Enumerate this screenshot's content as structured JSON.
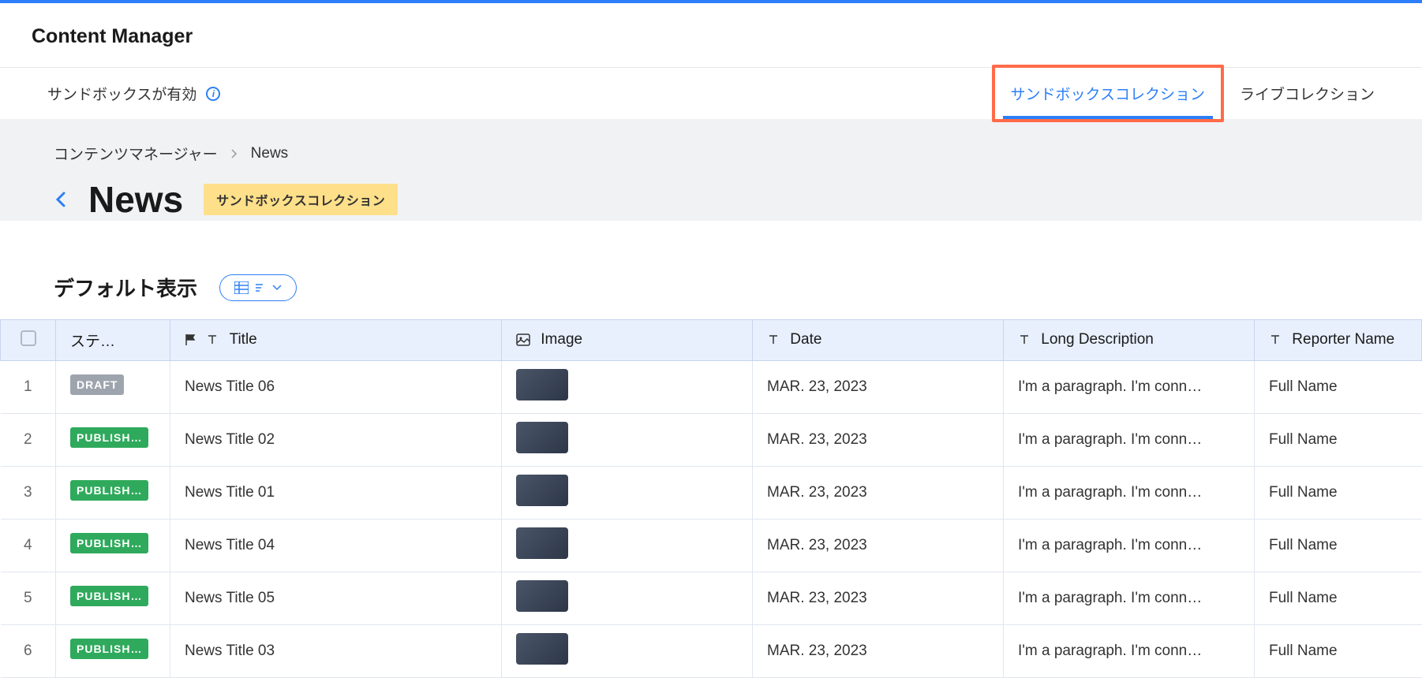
{
  "header": {
    "title": "Content Manager"
  },
  "subheader": {
    "sandbox_label": "サンドボックスが有効",
    "tabs": [
      {
        "label": "サンドボックスコレクション",
        "active": true,
        "highlighted": true
      },
      {
        "label": "ライブコレクション",
        "active": false,
        "highlighted": false
      }
    ]
  },
  "breadcrumb": {
    "items": [
      "コンテンツマネージャー",
      "News"
    ]
  },
  "page": {
    "title": "News",
    "badge": "サンドボックスコレクション"
  },
  "view": {
    "label": "デフォルト表示"
  },
  "table": {
    "columns": {
      "status": "ステ…",
      "title": "Title",
      "image": "Image",
      "date": "Date",
      "long_desc": "Long Description",
      "reporter": "Reporter Name"
    },
    "rows": [
      {
        "num": "1",
        "status": "DRAFT",
        "status_class": "draft",
        "title": "News Title 06",
        "date": "MAR. 23, 2023",
        "desc": "I'm a paragraph. I'm conn…",
        "reporter": "Full Name"
      },
      {
        "num": "2",
        "status": "PUBLISH…",
        "status_class": "published",
        "title": "News Title 02",
        "date": "MAR. 23, 2023",
        "desc": "I'm a paragraph. I'm conn…",
        "reporter": "Full Name"
      },
      {
        "num": "3",
        "status": "PUBLISH…",
        "status_class": "published",
        "title": "News Title 01",
        "date": "MAR. 23, 2023",
        "desc": "I'm a paragraph. I'm conn…",
        "reporter": "Full Name"
      },
      {
        "num": "4",
        "status": "PUBLISH…",
        "status_class": "published",
        "title": "News Title 04",
        "date": "MAR. 23, 2023",
        "desc": "I'm a paragraph. I'm conn…",
        "reporter": "Full Name"
      },
      {
        "num": "5",
        "status": "PUBLISH…",
        "status_class": "published",
        "title": "News Title 05",
        "date": "MAR. 23, 2023",
        "desc": "I'm a paragraph. I'm conn…",
        "reporter": "Full Name"
      },
      {
        "num": "6",
        "status": "PUBLISH…",
        "status_class": "published",
        "title": "News Title 03",
        "date": "MAR. 23, 2023",
        "desc": "I'm a paragraph. I'm conn…",
        "reporter": "Full Name"
      }
    ]
  },
  "colors": {
    "primary": "#2d7ff9",
    "highlight_border": "#ff6b4a",
    "badge_bg": "#ffe08a",
    "draft": "#9ea4ad",
    "published": "#2faa5c"
  }
}
